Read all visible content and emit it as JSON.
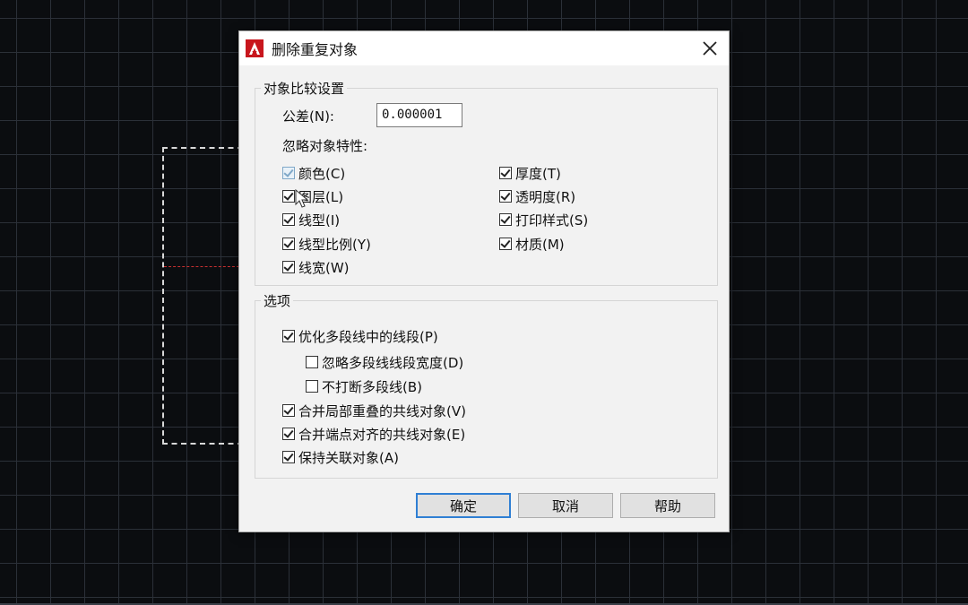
{
  "dialog": {
    "title": "删除重复对象",
    "close_icon": "close-icon",
    "app_icon": "autocad-logo-icon"
  },
  "compare_group": {
    "title": "对象比较设置",
    "tolerance_label": "公差(N):",
    "tolerance_value": "0.000001",
    "ignore_label": "忽略对象特性:",
    "properties": [
      {
        "label": "颜色(C)",
        "checked": true,
        "disabled": true
      },
      {
        "label": "图层(L)",
        "checked": true
      },
      {
        "label": "线型(I)",
        "checked": true
      },
      {
        "label": "线型比例(Y)",
        "checked": true
      },
      {
        "label": "线宽(W)",
        "checked": true
      },
      {
        "label": "厚度(T)",
        "checked": true
      },
      {
        "label": "透明度(R)",
        "checked": true
      },
      {
        "label": "打印样式(S)",
        "checked": true
      },
      {
        "label": "材质(M)",
        "checked": true
      }
    ]
  },
  "options_group": {
    "title": "选项",
    "items": [
      {
        "label": "优化多段线中的线段(P)",
        "checked": true
      },
      {
        "label": "忽略多段线线段宽度(D)",
        "checked": false
      },
      {
        "label": "不打断多段线(B)",
        "checked": false
      },
      {
        "label": "合并局部重叠的共线对象(V)",
        "checked": true
      },
      {
        "label": "合并端点对齐的共线对象(E)",
        "checked": true
      },
      {
        "label": "保持关联对象(A)",
        "checked": true
      }
    ]
  },
  "buttons": {
    "ok": "确定",
    "cancel": "取消",
    "help": "帮助"
  }
}
